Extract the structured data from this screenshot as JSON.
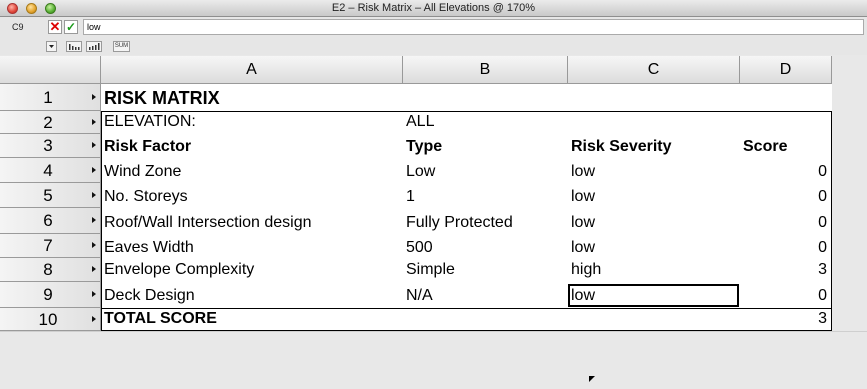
{
  "window": {
    "title": "E2 – Risk Matrix – All Elevations @ 170%"
  },
  "formula_bar": {
    "cell_ref": "C9",
    "value": "low",
    "cancel_symbol": "✕",
    "accept_symbol": "✓"
  },
  "toolbar": {
    "sum_label": "SUM"
  },
  "sheet": {
    "columns": [
      "A",
      "B",
      "C",
      "D"
    ],
    "row_numbers": [
      "1",
      "2",
      "3",
      "4",
      "5",
      "6",
      "7",
      "8",
      "9",
      "10"
    ],
    "title": "RISK MATRIX",
    "elevation_label": "ELEVATION:",
    "elevation_value": "ALL",
    "headers": {
      "factor": "Risk Factor",
      "type": "Type",
      "severity": "Risk Severity",
      "score": "Score"
    },
    "rows": [
      {
        "factor": "Wind Zone",
        "type": "Low",
        "severity": "low",
        "score": "0"
      },
      {
        "factor": "No. Storeys",
        "type": "1",
        "severity": "low",
        "score": "0"
      },
      {
        "factor": "Roof/Wall Intersection design",
        "type": "Fully Protected",
        "severity": "low",
        "score": "0"
      },
      {
        "factor": "Eaves Width",
        "type": "500",
        "severity": "low",
        "score": "0"
      },
      {
        "factor": "Envelope Complexity",
        "type": "Simple",
        "severity": "high",
        "score": "3"
      },
      {
        "factor": "Deck Design",
        "type": "N/A",
        "severity": "low",
        "score": "0"
      }
    ],
    "total_label": "TOTAL SCORE",
    "total_score": "3",
    "selected_cell": "C9"
  }
}
